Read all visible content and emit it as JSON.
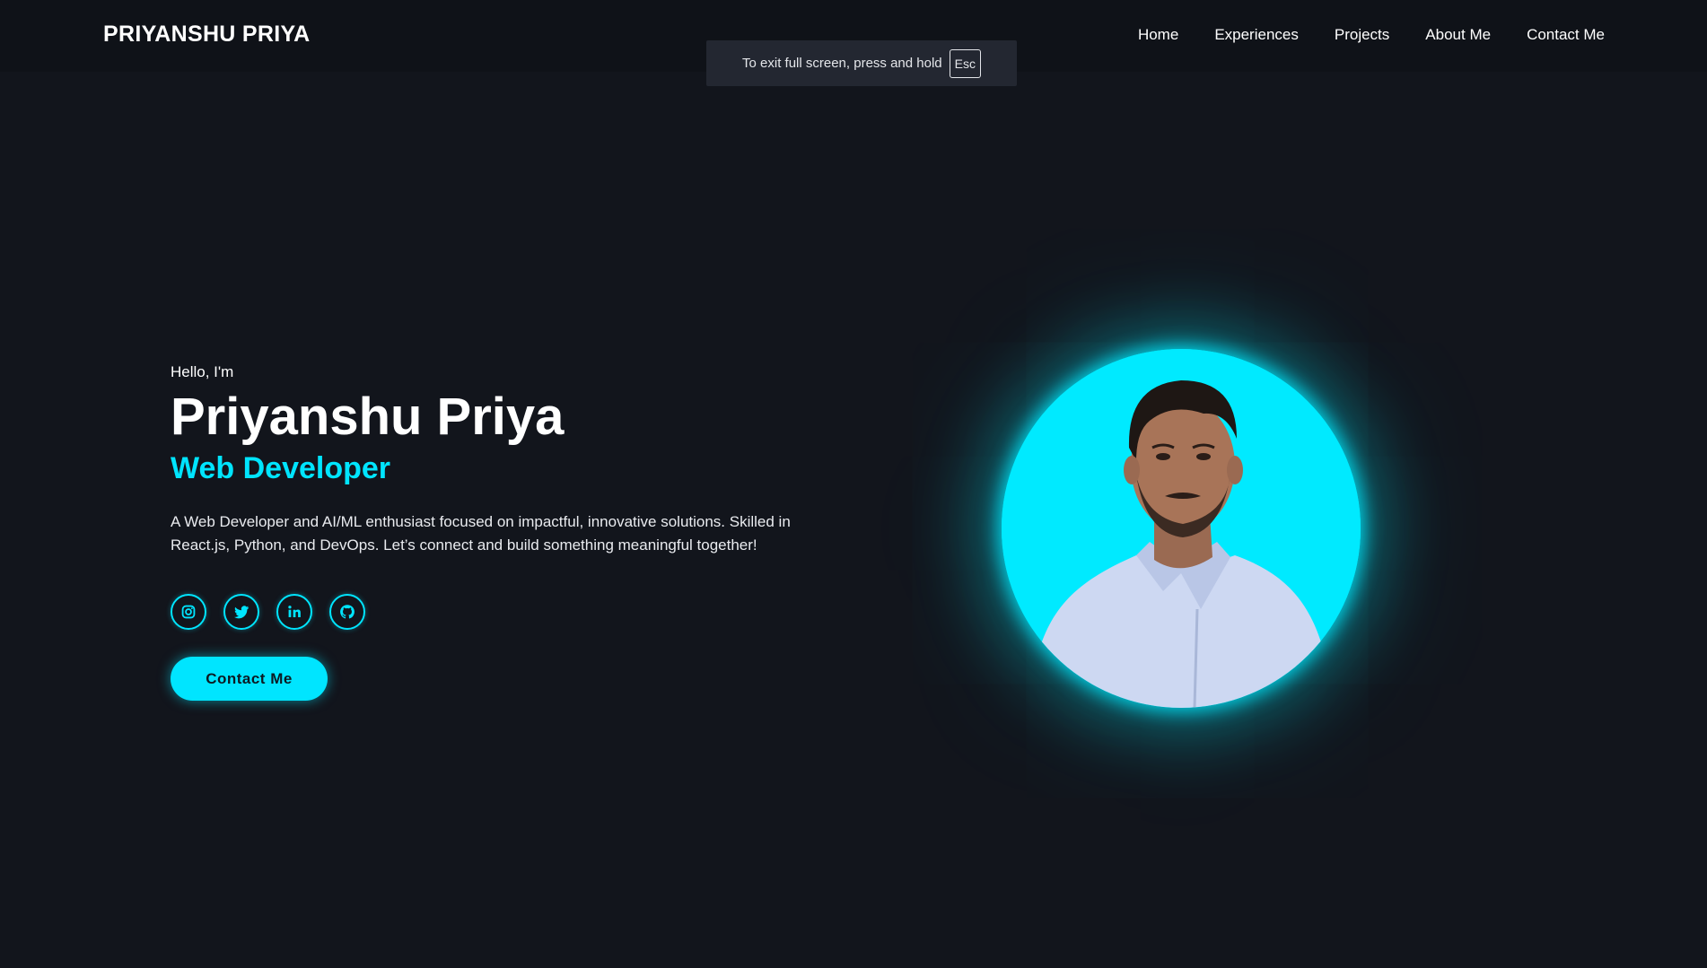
{
  "header": {
    "brand": "PRIYANSHU PRIYA",
    "nav": [
      "Home",
      "Experiences",
      "Projects",
      "About Me",
      "Contact Me"
    ]
  },
  "fullscreen_toast": {
    "text": "To exit full screen, press and hold",
    "key": "Esc"
  },
  "hero": {
    "greeting": "Hello, I'm",
    "name": "Priyanshu Priya",
    "role": "Web Developer",
    "bio": "A Web Developer and AI/ML enthusiast focused on impactful, innovative solutions. Skilled in React.js, Python, and DevOps. Let’s connect and build something meaningful together!",
    "socials": [
      "instagram-icon",
      "twitter-icon",
      "linkedin-icon",
      "github-icon"
    ],
    "cta_label": "Contact Me"
  },
  "colors": {
    "background": "#12151c",
    "accent": "#00e5ff",
    "text": "#ffffff"
  }
}
